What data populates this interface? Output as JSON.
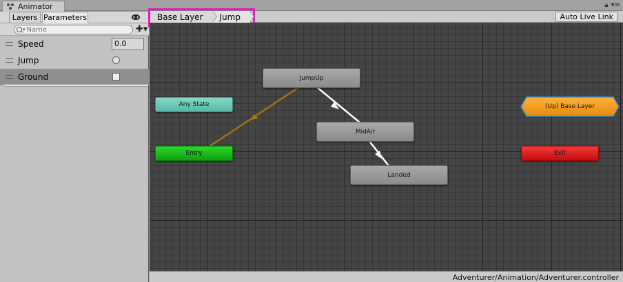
{
  "window": {
    "tab_label": "Animator",
    "tab_icon": "animator-icon",
    "controls": [
      "lock-icon",
      "menu-icon"
    ]
  },
  "left_panel": {
    "tabs": [
      {
        "label": "Layers",
        "active": false
      },
      {
        "label": "Parameters",
        "active": true
      }
    ],
    "eye_icon": "eye-icon",
    "search": {
      "placeholder": "Name",
      "value": ""
    },
    "add_icon": "add-icon",
    "parameters": [
      {
        "name": "Speed",
        "type": "float",
        "value": "0.0"
      },
      {
        "name": "Jump",
        "type": "trigger"
      },
      {
        "name": "Ground",
        "type": "bool",
        "checked": false,
        "selected": true
      }
    ]
  },
  "breadcrumb": {
    "items": [
      "Base Layer",
      "Jump"
    ],
    "auto_live_link": "Auto Live Link"
  },
  "graph": {
    "nodes": {
      "jumpup": "JumpUp",
      "midair": "MidAir",
      "landed": "Landed",
      "any_state": "Any State",
      "entry": "Entry",
      "exit": "Exit",
      "up_base_layer": "(Up) Base Layer"
    },
    "colors": {
      "state": "#9a9a9a",
      "any_state": "#6cc9b6",
      "entry": "#1cbc1c",
      "exit": "#e01e1e",
      "up_node": "#f39a1e",
      "up_node_outline": "#3a86d0",
      "default_transition": "#a86f17",
      "transition": "#ffffff",
      "highlight": "#e11fc0"
    }
  },
  "status": {
    "path": "Adventurer/Animation/Adventurer.controller"
  }
}
